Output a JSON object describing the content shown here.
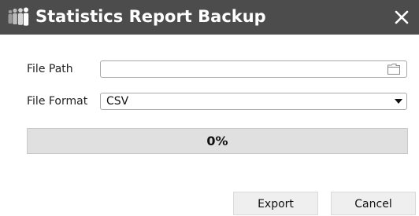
{
  "dialog": {
    "title": "Statistics Report Backup",
    "title_icon": "people-counting-icon",
    "close_icon": "close-icon"
  },
  "form": {
    "file_path": {
      "label": "File Path",
      "value": "",
      "icon": "folder-icon"
    },
    "file_format": {
      "label": "File Format",
      "selected": "CSV",
      "icon": "chevron-down-icon"
    }
  },
  "progress": {
    "percent_text": "0%",
    "value": 0
  },
  "buttons": {
    "export_label": "Export",
    "cancel_label": "Cancel"
  },
  "colors": {
    "titlebar_bg": "#4c4c4c",
    "progress_bg": "#e0e0e0"
  }
}
